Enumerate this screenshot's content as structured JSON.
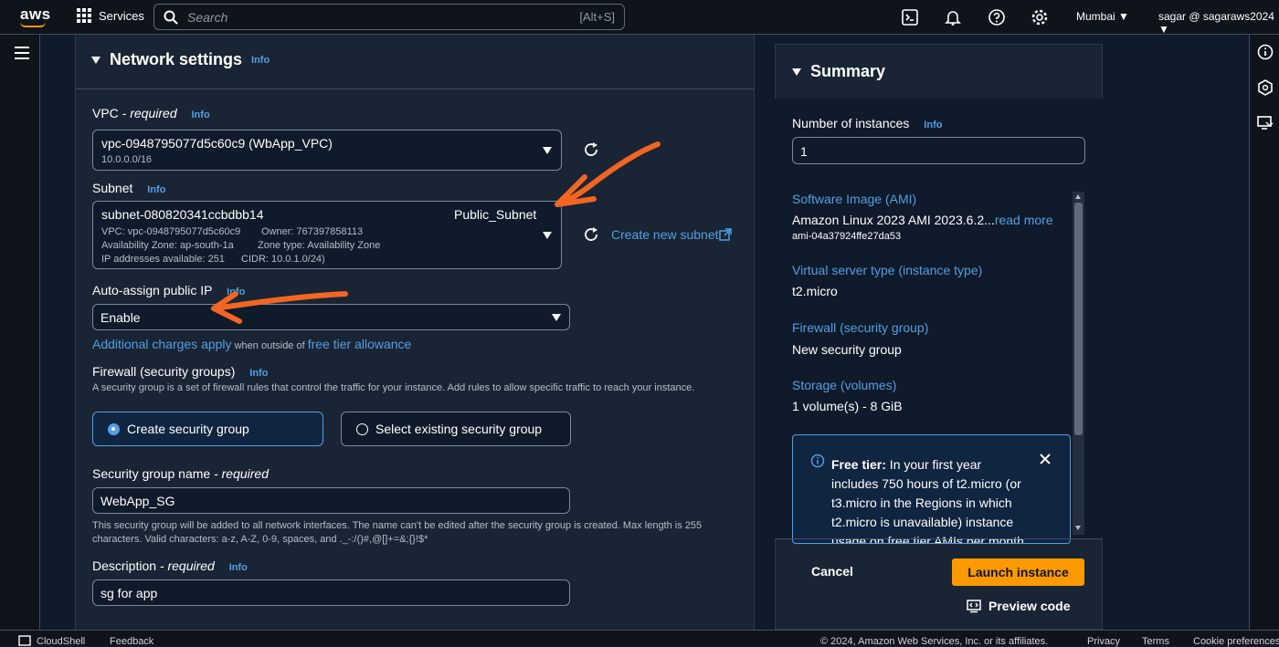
{
  "topbar": {
    "logo": "aws",
    "services": "Services",
    "search_placeholder": "Search",
    "search_shortcut": "[Alt+S]",
    "region": "Mumbai",
    "user": "sagar @ sagaraws2024"
  },
  "network": {
    "title": "Network settings",
    "info": "Info",
    "vpc_label": "VPC",
    "vpc_required": " - required",
    "vpc_info": "Info",
    "vpc_value": "vpc-0948795077d5c60c9 (WbApp_VPC)",
    "vpc_cidr": "10.0.0.0/16",
    "subnet_label": "Subnet",
    "subnet_info": "Info",
    "subnet_id": "subnet-080820341ccbdbb14",
    "subnet_name": "Public_Subnet",
    "subnet_vpc": "VPC: vpc-0948795077d5c60c9",
    "subnet_owner": "Owner: 767397858113",
    "subnet_az": "Availability Zone: ap-south-1a",
    "subnet_zone_type": "Zone type: Availability Zone",
    "subnet_ips": "IP addresses available: 251",
    "subnet_cidr": "CIDR: 10.0.1.0/24)",
    "create_subnet": "Create new subnet",
    "auto_ip_label": "Auto-assign public IP",
    "auto_ip_info": "Info",
    "auto_ip_value": "Enable",
    "charges_link": "Additional charges apply",
    "charges_text": " when outside of ",
    "free_tier_link": "free tier allowance",
    "firewall_label": "Firewall (security groups)",
    "firewall_info": "Info",
    "firewall_desc": "A security group is a set of firewall rules that control the traffic for your instance. Add rules to allow specific traffic to reach your instance.",
    "radio_create": "Create security group",
    "radio_existing": "Select existing security group",
    "sg_name_label": "Security group name",
    "sg_name_required": " - required",
    "sg_name_value": "WebApp_SG",
    "sg_name_help": "This security group will be added to all network interfaces. The name can't be edited after the security group is created. Max length is 255 characters. Valid characters: a-z, A-Z, 0-9, spaces, and ._-:/()#,@[]+=&;{}!$*",
    "desc_label": "Description",
    "desc_required": " - required",
    "desc_info": "Info",
    "desc_value": "sg for app"
  },
  "summary": {
    "title": "Summary",
    "instances_label": "Number of instances",
    "instances_info": "Info",
    "instances_value": "1",
    "ami_link": "Software Image (AMI)",
    "ami_value": "Amazon Linux 2023 AMI 2023.6.2...",
    "ami_read_more": "read more",
    "ami_id": "ami-04a37924ffe27da53",
    "type_link": "Virtual server type (instance type)",
    "type_value": "t2.micro",
    "fw_link": "Firewall (security group)",
    "fw_value": "New security group",
    "storage_link": "Storage (volumes)",
    "storage_value": "1 volume(s) - 8 GiB",
    "free_tier_bold": "Free tier:",
    "free_tier_text": " In your first year includes 750 hours of t2.micro (or t3.micro in the Regions in which t2.micro is unavailable) instance usage on free tier AMIs per month",
    "cancel": "Cancel",
    "launch": "Launch instance",
    "preview": "Preview code"
  },
  "footer": {
    "cloudshell": "CloudShell",
    "feedback": "Feedback",
    "copyright": "© 2024, Amazon Web Services, Inc. or its affiliates.",
    "privacy": "Privacy",
    "terms": "Terms",
    "cookies": "Cookie preferences"
  },
  "colors": {
    "accent": "#539fe5",
    "launch": "#ff9900",
    "annotation_arrow": "#f26522"
  }
}
